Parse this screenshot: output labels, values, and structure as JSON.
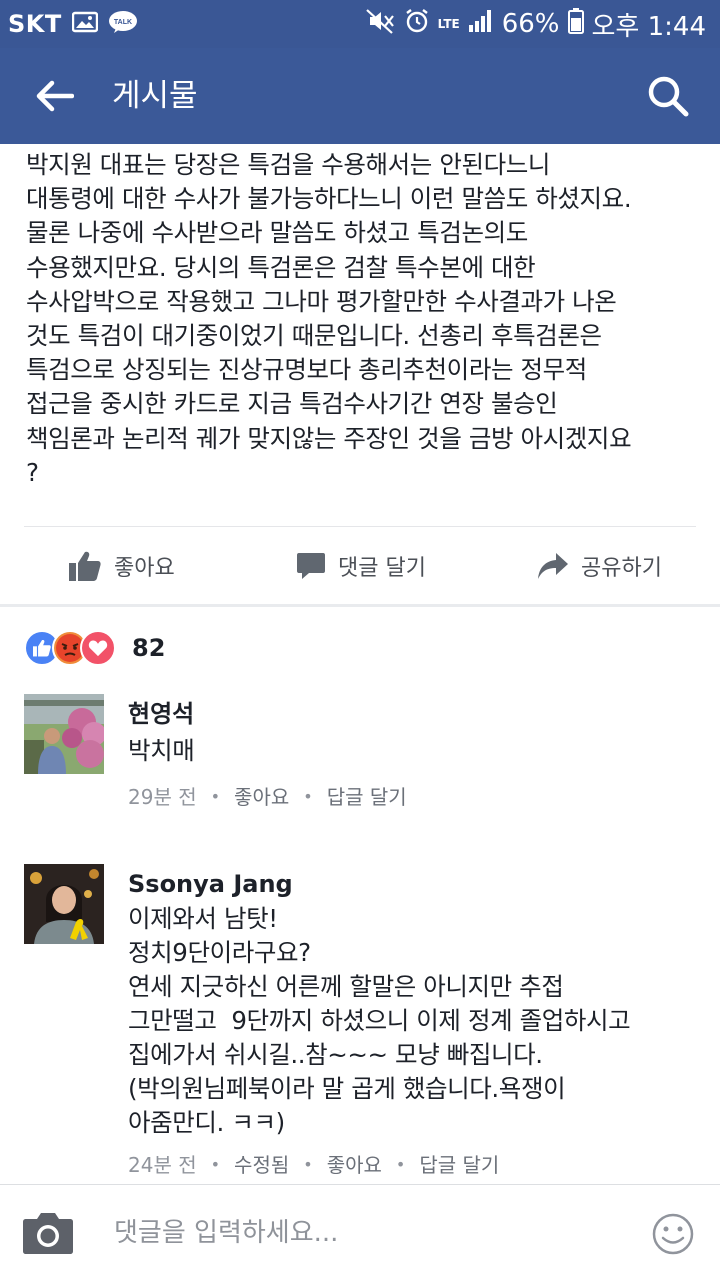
{
  "status_bar": {
    "carrier": "SKT",
    "network": "LTE",
    "battery": "66%",
    "time": "오후 1:44"
  },
  "header": {
    "title": "게시물"
  },
  "post": {
    "text": "박지원 대표는 당장은 특검을 수용해서는 안된다느니\n대통령에 대한 수사가 불가능하다느니 이런 말씀도 하셨지요.\n물론 나중에 수사받으라 말씀도 하셨고 특검논의도\n수용했지만요. 당시의 특검론은 검찰 특수본에 대한\n수사압박으로 작용했고 그나마 평가할만한 수사결과가 나온\n것도 특검이 대기중이었기 때문입니다. 선총리 후특검론은\n특검으로 상징되는 진상규명보다 총리추천이라는 정무적\n접근을 중시한 카드로 지금 특검수사기간 연장 불승인\n책임론과 논리적 궤가 맞지않는 주장인 것을 금방 아시겠지요\n?",
    "actions": {
      "like": "좋아요",
      "comment": "댓글 달기",
      "share": "공유하기"
    },
    "reaction_count": "82"
  },
  "comments": [
    {
      "author": "현영석",
      "text": "박치매",
      "time": "29분 전",
      "like": "좋아요",
      "reply": "답글 달기"
    },
    {
      "author": "Ssonya Jang",
      "text": "이제와서 남탓!\n정치9단이라구요?\n연세 지긋하신 어른께 할말은 아니지만 추접\n그만떨고  9단까지 하셨으니 이제 정계 졸업하시고\n집에가서 쉬시길..참~~~ 모냥 빠집니다.\n(박의원님페북이라 말 곱게 했습니다.욕쟁이\n아줌만디. ㅋㅋ)",
      "time": "24분 전",
      "edited": "수정됨",
      "like": "좋아요",
      "reply": "답글 달기"
    }
  ],
  "composer": {
    "placeholder": "댓글을 입력하세요..."
  },
  "colors": {
    "brand": "#3b5998",
    "status_bar": "#3a5795",
    "meta_text": "#90949c"
  },
  "icons": [
    "back-arrow-icon",
    "search-icon",
    "like-thumb-icon",
    "comment-bubble-icon",
    "share-arrow-icon",
    "camera-icon",
    "emoji-icon"
  ]
}
